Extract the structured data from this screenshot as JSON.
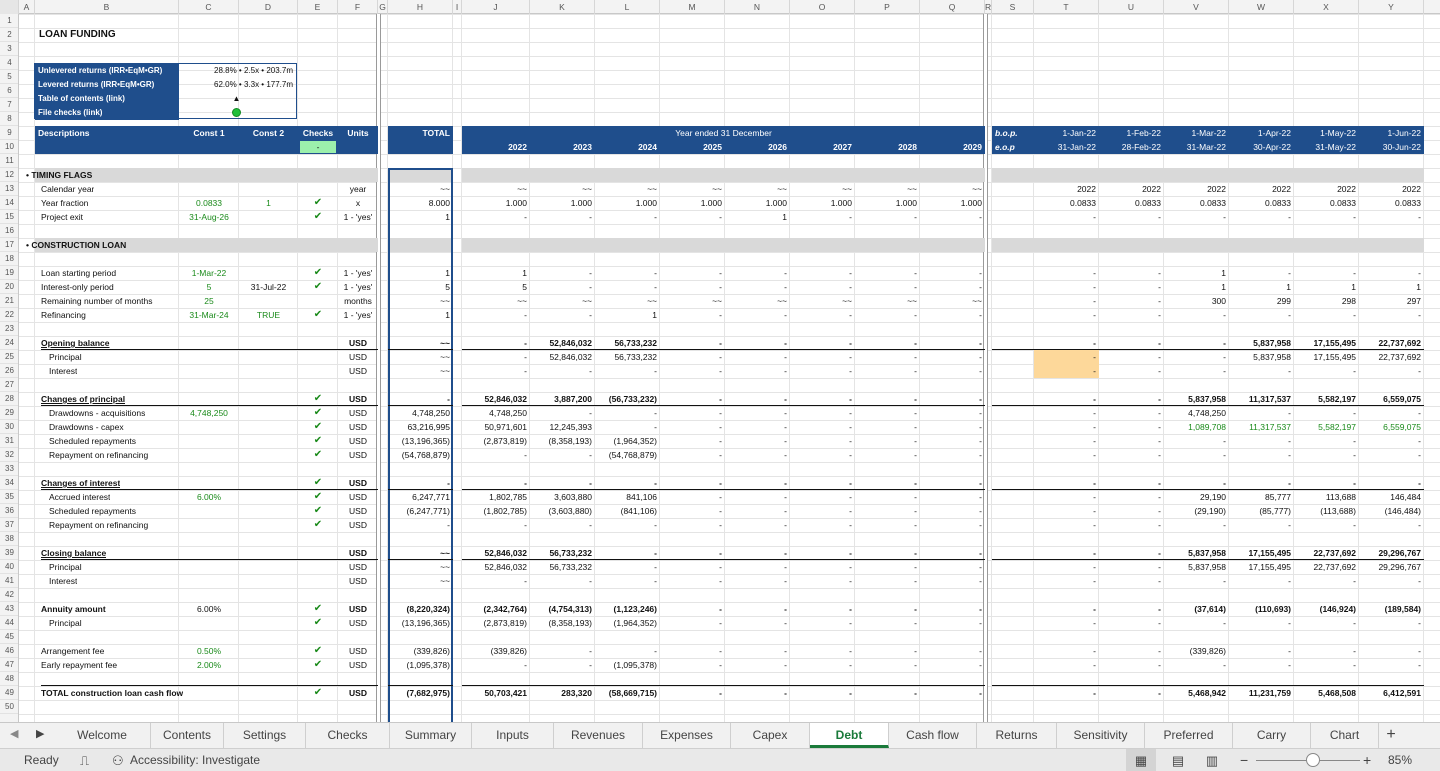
{
  "sheet": {
    "title": "LOAN FUNDING",
    "summary": [
      {
        "label": "Unlevered returns (IRR•EqM•GR)",
        "value": "28.8% • 2.5x • 203.7m"
      },
      {
        "label": "Levered returns (IRR•EqM•GR)",
        "value": "62.0% • 3.3x • 177.7m"
      },
      {
        "label": "Table of contents (link)",
        "value": "▲"
      },
      {
        "label": "File checks (link)",
        "value": ""
      }
    ],
    "file_check_color": "#1fbf3a"
  },
  "colors": {
    "header_band": "#1f4e8c",
    "section_bar": "#d9d9d9",
    "input_green": "#1a8a1a",
    "highlight": "#fdd89a",
    "check_cell": "#9cf0ac",
    "active_tab": "#1a7a3a"
  },
  "columns": [
    "A",
    "B",
    "C",
    "D",
    "E",
    "F",
    "G",
    "H",
    "I",
    "J",
    "K",
    "L",
    "M",
    "N",
    "O",
    "P",
    "Q",
    "R",
    "S",
    "T",
    "U",
    "V",
    "W",
    "X",
    "Y"
  ],
  "headers": {
    "descriptions": "Descriptions",
    "const1": "Const 1",
    "const2": "Const 2",
    "checks": "Checks",
    "units": "Units",
    "total": "TOTAL",
    "year_ended": "Year ended 31 December",
    "check_value": "-",
    "years": [
      "2022",
      "2023",
      "2024",
      "2025",
      "2026",
      "2027",
      "2028",
      "2029"
    ],
    "bop": "b.o.p.",
    "eop": "e.o.p",
    "month_start": [
      "1-Jan-22",
      "1-Feb-22",
      "1-Mar-22",
      "1-Apr-22",
      "1-May-22",
      "1-Jun-22"
    ],
    "month_end": [
      "31-Jan-22",
      "28-Feb-22",
      "31-Mar-22",
      "30-Apr-22",
      "31-May-22",
      "30-Jun-22"
    ]
  },
  "sections": [
    "TIMING FLAGS",
    "CONSTRUCTION LOAN"
  ],
  "rows": [
    {
      "r": 13,
      "d": "Calendar year",
      "f": "year",
      "h": "~~",
      "y": [
        "~~",
        "~~",
        "~~",
        "~~",
        "~~",
        "~~",
        "~~",
        "~~"
      ],
      "m": [
        "2022",
        "2022",
        "2022",
        "2022",
        "2022",
        "2022"
      ]
    },
    {
      "r": 14,
      "d": "Year fraction",
      "c": "0.0833",
      "cg": true,
      "dv": "1",
      "dg": true,
      "e": "✔",
      "f": "x",
      "h": "8.000",
      "y": [
        "1.000",
        "1.000",
        "1.000",
        "1.000",
        "1.000",
        "1.000",
        "1.000",
        "1.000"
      ],
      "m": [
        "0.0833",
        "0.0833",
        "0.0833",
        "0.0833",
        "0.0833",
        "0.0833"
      ]
    },
    {
      "r": 15,
      "d": "Project exit",
      "c": "31-Aug-26",
      "cg": true,
      "e": "✔",
      "f": "1 - 'yes'",
      "h": "1",
      "y": [
        "-",
        "-",
        "-",
        "-",
        "1",
        "-",
        "-",
        "-"
      ],
      "m": [
        "-",
        "-",
        "-",
        "-",
        "-",
        "-"
      ]
    },
    {
      "r": 19,
      "d": "Loan starting period",
      "c": "1-Mar-22",
      "cg": true,
      "e": "✔",
      "f": "1 - 'yes'",
      "h": "1",
      "y": [
        "1",
        "-",
        "-",
        "-",
        "-",
        "-",
        "-",
        "-"
      ],
      "m": [
        "-",
        "-",
        "1",
        "-",
        "-",
        "-"
      ]
    },
    {
      "r": 20,
      "d": "Interest-only period",
      "c": "5",
      "cg": true,
      "dv": "31-Jul-22",
      "e": "✔",
      "f": "1 - 'yes'",
      "h": "5",
      "y": [
        "5",
        "-",
        "-",
        "-",
        "-",
        "-",
        "-",
        "-"
      ],
      "m": [
        "-",
        "-",
        "1",
        "1",
        "1",
        "1"
      ]
    },
    {
      "r": 21,
      "d": "Remaining number of months",
      "c": "25",
      "cg": true,
      "f": "months",
      "h": "~~",
      "y": [
        "~~",
        "~~",
        "~~",
        "~~",
        "~~",
        "~~",
        "~~",
        "~~"
      ],
      "m": [
        "-",
        "-",
        "300",
        "299",
        "298",
        "297"
      ]
    },
    {
      "r": 22,
      "d": "Refinancing",
      "c": "31-Mar-24",
      "cg": true,
      "dv": "TRUE",
      "dg": true,
      "e": "✔",
      "f": "1 - 'yes'",
      "h": "1",
      "y": [
        "-",
        "-",
        "1",
        "-",
        "-",
        "-",
        "-",
        "-"
      ],
      "m": [
        "-",
        "-",
        "-",
        "-",
        "-",
        "-"
      ]
    },
    {
      "r": 24,
      "d": "Opening balance",
      "bold": true,
      "ul": true,
      "f": "USD",
      "h": "~~",
      "y": [
        "-",
        "52,846,032",
        "56,733,232",
        "-",
        "-",
        "-",
        "-",
        "-"
      ],
      "m": [
        "-",
        "-",
        "-",
        "5,837,958",
        "17,155,495",
        "22,737,692"
      ]
    },
    {
      "r": 25,
      "d": "Principal",
      "ind": true,
      "f": "USD",
      "h": "~~",
      "y": [
        "-",
        "52,846,032",
        "56,733,232",
        "-",
        "-",
        "-",
        "-",
        "-"
      ],
      "m": [
        "-",
        "-",
        "-",
        "5,837,958",
        "17,155,495",
        "22,737,692"
      ],
      "hl": true
    },
    {
      "r": 26,
      "d": "Interest",
      "ind": true,
      "f": "USD",
      "h": "~~",
      "y": [
        "-",
        "-",
        "-",
        "-",
        "-",
        "-",
        "-",
        "-"
      ],
      "m": [
        "-",
        "-",
        "-",
        "-",
        "-",
        "-"
      ],
      "hl": true
    },
    {
      "r": 28,
      "d": "Changes of principal",
      "bold": true,
      "ul": true,
      "e": "✔",
      "f": "USD",
      "h": "-",
      "y": [
        "52,846,032",
        "3,887,200",
        "(56,733,232)",
        "-",
        "-",
        "-",
        "-",
        "-"
      ],
      "m": [
        "-",
        "-",
        "5,837,958",
        "11,317,537",
        "5,582,197",
        "6,559,075"
      ]
    },
    {
      "r": 29,
      "d": "Drawdowns - acquisitions",
      "ind": true,
      "c": "4,748,250",
      "cg": true,
      "e": "✔",
      "f": "USD",
      "h": "4,748,250",
      "y": [
        "4,748,250",
        "-",
        "-",
        "-",
        "-",
        "-",
        "-",
        "-"
      ],
      "m": [
        "-",
        "-",
        "4,748,250",
        "-",
        "-",
        "-"
      ]
    },
    {
      "r": 30,
      "d": "Drawdowns - capex",
      "ind": true,
      "e": "✔",
      "f": "USD",
      "h": "63,216,995",
      "y": [
        "50,971,601",
        "12,245,393",
        "-",
        "-",
        "-",
        "-",
        "-",
        "-"
      ],
      "m": [
        "-",
        "-",
        "1,089,708",
        "11,317,537",
        "5,582,197",
        "6,559,075"
      ],
      "mg": true
    },
    {
      "r": 31,
      "d": "Scheduled repayments",
      "ind": true,
      "e": "✔",
      "f": "USD",
      "h": "(13,196,365)",
      "y": [
        "(2,873,819)",
        "(8,358,193)",
        "(1,964,352)",
        "-",
        "-",
        "-",
        "-",
        "-"
      ],
      "m": [
        "-",
        "-",
        "-",
        "-",
        "-",
        "-"
      ]
    },
    {
      "r": 32,
      "d": "Repayment on refinancing",
      "ind": true,
      "e": "✔",
      "f": "USD",
      "h": "(54,768,879)",
      "y": [
        "-",
        "-",
        "(54,768,879)",
        "-",
        "-",
        "-",
        "-",
        "-"
      ],
      "m": [
        "-",
        "-",
        "-",
        "-",
        "-",
        "-"
      ]
    },
    {
      "r": 34,
      "d": "Changes of interest",
      "bold": true,
      "ul": true,
      "e": "✔",
      "f": "USD",
      "h": "-",
      "y": [
        "-",
        "-",
        "-",
        "-",
        "-",
        "-",
        "-",
        "-"
      ],
      "m": [
        "-",
        "-",
        "-",
        "-",
        "-",
        "-"
      ]
    },
    {
      "r": 35,
      "d": "Accrued interest",
      "ind": true,
      "c": "6.00%",
      "cg": true,
      "e": "✔",
      "f": "USD",
      "h": "6,247,771",
      "y": [
        "1,802,785",
        "3,603,880",
        "841,106",
        "-",
        "-",
        "-",
        "-",
        "-"
      ],
      "m": [
        "-",
        "-",
        "29,190",
        "85,777",
        "113,688",
        "146,484"
      ]
    },
    {
      "r": 36,
      "d": "Scheduled repayments",
      "ind": true,
      "e": "✔",
      "f": "USD",
      "h": "(6,247,771)",
      "y": [
        "(1,802,785)",
        "(3,603,880)",
        "(841,106)",
        "-",
        "-",
        "-",
        "-",
        "-"
      ],
      "m": [
        "-",
        "-",
        "(29,190)",
        "(85,777)",
        "(113,688)",
        "(146,484)"
      ]
    },
    {
      "r": 37,
      "d": "Repayment on refinancing",
      "ind": true,
      "e": "✔",
      "f": "USD",
      "h": "-",
      "y": [
        "-",
        "-",
        "-",
        "-",
        "-",
        "-",
        "-",
        "-"
      ],
      "m": [
        "-",
        "-",
        "-",
        "-",
        "-",
        "-"
      ]
    },
    {
      "r": 39,
      "d": "Closing balance",
      "bold": true,
      "ul": true,
      "f": "USD",
      "h": "~~",
      "y": [
        "52,846,032",
        "56,733,232",
        "-",
        "-",
        "-",
        "-",
        "-",
        "-"
      ],
      "m": [
        "-",
        "-",
        "5,837,958",
        "17,155,495",
        "22,737,692",
        "29,296,767"
      ]
    },
    {
      "r": 40,
      "d": "Principal",
      "ind": true,
      "f": "USD",
      "h": "~~",
      "y": [
        "52,846,032",
        "56,733,232",
        "-",
        "-",
        "-",
        "-",
        "-",
        "-"
      ],
      "m": [
        "-",
        "-",
        "5,837,958",
        "17,155,495",
        "22,737,692",
        "29,296,767"
      ]
    },
    {
      "r": 41,
      "d": "Interest",
      "ind": true,
      "f": "USD",
      "h": "~~",
      "y": [
        "-",
        "-",
        "-",
        "-",
        "-",
        "-",
        "-",
        "-"
      ],
      "m": [
        "-",
        "-",
        "-",
        "-",
        "-",
        "-"
      ]
    },
    {
      "r": 43,
      "d": "Annuity amount",
      "bold": true,
      "c": "6.00%",
      "e": "✔",
      "f": "USD",
      "h": "(8,220,324)",
      "y": [
        "(2,342,764)",
        "(4,754,313)",
        "(1,123,246)",
        "-",
        "-",
        "-",
        "-",
        "-"
      ],
      "m": [
        "-",
        "-",
        "(37,614)",
        "(110,693)",
        "(146,924)",
        "(189,584)"
      ]
    },
    {
      "r": 44,
      "d": "Principal",
      "ind": true,
      "e": "✔",
      "f": "USD",
      "h": "(13,196,365)",
      "y": [
        "(2,873,819)",
        "(8,358,193)",
        "(1,964,352)",
        "-",
        "-",
        "-",
        "-",
        "-"
      ],
      "m": [
        "-",
        "-",
        "-",
        "-",
        "-",
        "-"
      ]
    },
    {
      "r": 46,
      "d": "Arrangement fee",
      "c": "0.50%",
      "cg": true,
      "e": "✔",
      "f": "USD",
      "h": "(339,826)",
      "y": [
        "(339,826)",
        "-",
        "-",
        "-",
        "-",
        "-",
        "-",
        "-"
      ],
      "m": [
        "-",
        "-",
        "(339,826)",
        "-",
        "-",
        "-"
      ]
    },
    {
      "r": 47,
      "d": "Early repayment fee",
      "c": "2.00%",
      "cg": true,
      "e": "✔",
      "f": "USD",
      "h": "(1,095,378)",
      "y": [
        "-",
        "-",
        "(1,095,378)",
        "-",
        "-",
        "-",
        "-",
        "-"
      ],
      "m": [
        "-",
        "-",
        "-",
        "-",
        "-",
        "-"
      ]
    },
    {
      "r": 49,
      "d": "TOTAL construction loan cash flow",
      "bold": true,
      "e": "✔",
      "f": "USD",
      "h": "(7,682,975)",
      "y": [
        "50,703,421",
        "283,320",
        "(58,669,715)",
        "-",
        "-",
        "-",
        "-",
        "-"
      ],
      "m": [
        "-",
        "-",
        "5,468,942",
        "11,231,759",
        "5,468,508",
        "6,412,591"
      ]
    }
  ],
  "tabs": [
    "Welcome",
    "Contents",
    "Settings",
    "Checks",
    "Summary",
    "Inputs",
    "Revenues",
    "Expenses",
    "Capex",
    "Debt",
    "Cash flow",
    "Returns",
    "Sensitivity",
    "Preferred",
    "Carry",
    "Chart"
  ],
  "active_tab": "Debt",
  "add_tab": "+",
  "status": {
    "ready": "Ready",
    "accessibility": "Accessibility: Investigate",
    "zoom": "85%",
    "zoom_level": 0.85
  }
}
